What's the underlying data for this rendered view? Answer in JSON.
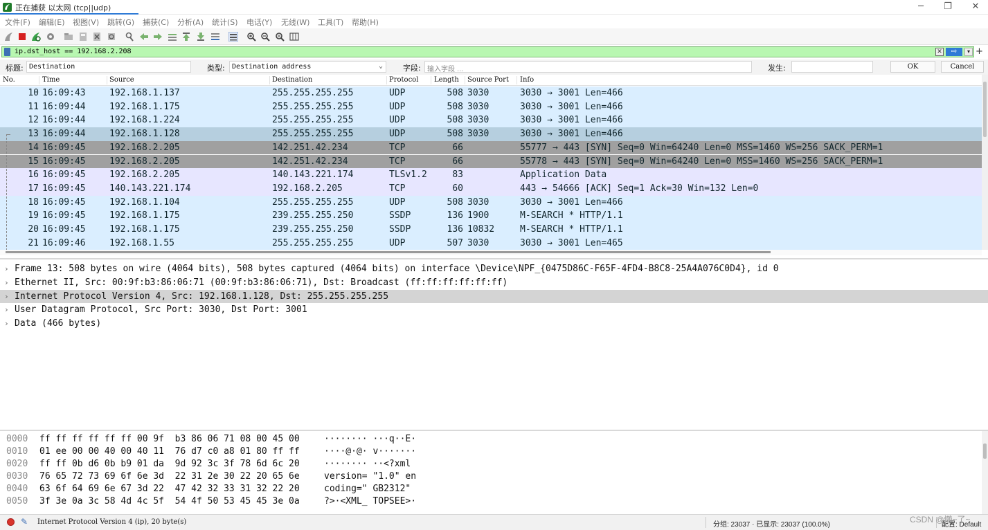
{
  "window": {
    "title": "正在捕获 以太网 (tcp||udp)",
    "minimize": "─",
    "maximize": "❐",
    "close": "✕"
  },
  "menu": [
    "文件(F)",
    "编辑(E)",
    "视图(V)",
    "跳转(G)",
    "捕获(C)",
    "分析(A)",
    "统计(S)",
    "电话(Y)",
    "无线(W)",
    "工具(T)",
    "帮助(H)"
  ],
  "toolbar_icons": [
    "shark-fin-icon",
    "stop-icon",
    "restart-icon",
    "options-icon",
    "open-file-icon",
    "save-file-icon",
    "close-file-icon",
    "reload-icon",
    "find-icon",
    "back-icon",
    "forward-icon",
    "goto-packet-icon",
    "first-packet-icon",
    "last-packet-icon",
    "autoscroll-icon",
    "colorize-icon",
    "zoom-in-icon",
    "zoom-out-icon",
    "normal-size-icon",
    "resize-columns-icon"
  ],
  "filter": {
    "value": "ip.dst_host  == 192.168.2.208",
    "clear": "✕",
    "apply": "⇨",
    "dropdown": "▾",
    "add": "+"
  },
  "column_editor": {
    "title_label": "标题:",
    "title_value": "Destination",
    "type_label": "类型:",
    "type_value": "Destination address",
    "field_label": "字段:",
    "field_placeholder": "输入字段 …",
    "occurrence_label": "发生:",
    "occurrence_value": "",
    "ok": "OK",
    "cancel": "Cancel"
  },
  "packet_list": {
    "columns": [
      "No.",
      "Time",
      "Source",
      "Destination",
      "Protocol",
      "Length",
      "Source Port",
      "Info"
    ],
    "rows": [
      {
        "no": "10",
        "time": "16:09:43",
        "src": "192.168.1.137",
        "dst": "255.255.255.255",
        "proto": "UDP",
        "len": "508",
        "sport": "3030",
        "info": "3030 → 3001 Len=466",
        "bg": "#daeeff",
        "fg": "#12272e"
      },
      {
        "no": "11",
        "time": "16:09:44",
        "src": "192.168.1.175",
        "dst": "255.255.255.255",
        "proto": "UDP",
        "len": "508",
        "sport": "3030",
        "info": "3030 → 3001 Len=466",
        "bg": "#daeeff",
        "fg": "#12272e"
      },
      {
        "no": "12",
        "time": "16:09:44",
        "src": "192.168.1.224",
        "dst": "255.255.255.255",
        "proto": "UDP",
        "len": "508",
        "sport": "3030",
        "info": "3030 → 3001 Len=466",
        "bg": "#daeeff",
        "fg": "#12272e"
      },
      {
        "no": "13",
        "time": "16:09:44",
        "src": "192.168.1.128",
        "dst": "255.255.255.255",
        "proto": "UDP",
        "len": "508",
        "sport": "3030",
        "info": "3030 → 3001 Len=466",
        "bg": "#b6cfdf",
        "fg": "#12272e"
      },
      {
        "no": "14",
        "time": "16:09:45",
        "src": "192.168.2.205",
        "dst": "142.251.42.234",
        "proto": "TCP",
        "len": "66",
        "sport": "",
        "info": "55777 → 443 [SYN] Seq=0 Win=64240 Len=0 MSS=1460 WS=256 SACK_PERM=1",
        "bg": "#a0a0a0",
        "fg": "#12272e"
      },
      {
        "no": "15",
        "time": "16:09:45",
        "src": "192.168.2.205",
        "dst": "142.251.42.234",
        "proto": "TCP",
        "len": "66",
        "sport": "",
        "info": "55778 → 443 [SYN] Seq=0 Win=64240 Len=0 MSS=1460 WS=256 SACK_PERM=1",
        "bg": "#a0a0a0",
        "fg": "#12272e"
      },
      {
        "no": "16",
        "time": "16:09:45",
        "src": "192.168.2.205",
        "dst": "140.143.221.174",
        "proto": "TLSv1.2",
        "len": "83",
        "sport": "",
        "info": "Application Data",
        "bg": "#e7e6ff",
        "fg": "#12272e"
      },
      {
        "no": "17",
        "time": "16:09:45",
        "src": "140.143.221.174",
        "dst": "192.168.2.205",
        "proto": "TCP",
        "len": "60",
        "sport": "",
        "info": "443 → 54666 [ACK] Seq=1 Ack=30 Win=132 Len=0",
        "bg": "#e7e6ff",
        "fg": "#12272e"
      },
      {
        "no": "18",
        "time": "16:09:45",
        "src": "192.168.1.104",
        "dst": "255.255.255.255",
        "proto": "UDP",
        "len": "508",
        "sport": "3030",
        "info": "3030 → 3001 Len=466",
        "bg": "#daeeff",
        "fg": "#12272e"
      },
      {
        "no": "19",
        "time": "16:09:45",
        "src": "192.168.1.175",
        "dst": "239.255.255.250",
        "proto": "SSDP",
        "len": "136",
        "sport": "1900",
        "info": "M-SEARCH * HTTP/1.1",
        "bg": "#daeeff",
        "fg": "#12272e"
      },
      {
        "no": "20",
        "time": "16:09:45",
        "src": "192.168.1.175",
        "dst": "239.255.255.250",
        "proto": "SSDP",
        "len": "136",
        "sport": "10832",
        "info": "M-SEARCH * HTTP/1.1",
        "bg": "#daeeff",
        "fg": "#12272e"
      },
      {
        "no": "21",
        "time": "16:09:46",
        "src": "192.168.1.55",
        "dst": "255.255.255.255",
        "proto": "UDP",
        "len": "507",
        "sport": "3030",
        "info": "3030 → 3001 Len=465",
        "bg": "#daeeff",
        "fg": "#12272e"
      }
    ]
  },
  "details": [
    {
      "text": "Frame 13: 508 bytes on wire (4064 bits), 508 bytes captured (4064 bits) on interface \\Device\\NPF_{0475D86C-F65F-4FD4-B8C8-25A4A076C0D4}, id 0",
      "bg": "#ffffff"
    },
    {
      "text": "Ethernet II, Src: 00:9f:b3:86:06:71 (00:9f:b3:86:06:71), Dst: Broadcast (ff:ff:ff:ff:ff:ff)",
      "bg": "#ffffff"
    },
    {
      "text": "Internet Protocol Version 4, Src: 192.168.1.128, Dst: 255.255.255.255",
      "bg": "#d4d4d4"
    },
    {
      "text": "User Datagram Protocol, Src Port: 3030, Dst Port: 3001",
      "bg": "#ffffff"
    },
    {
      "text": "Data (466 bytes)",
      "bg": "#ffffff"
    }
  ],
  "bytes": [
    {
      "off": "0000",
      "hex": "ff ff ff ff ff ff 00 9f  b3 86 06 71 08 00 45 00",
      "ascii": "········ ···q··E·"
    },
    {
      "off": "0010",
      "hex": "01 ee 00 00 40 00 40 11  76 d7 c0 a8 01 80 ff ff",
      "ascii": "····@·@· v·······"
    },
    {
      "off": "0020",
      "hex": "ff ff 0b d6 0b b9 01 da  9d 92 3c 3f 78 6d 6c 20",
      "ascii": "········ ··<?xml "
    },
    {
      "off": "0030",
      "hex": "76 65 72 73 69 6f 6e 3d  22 31 2e 30 22 20 65 6e",
      "ascii": "version= \"1.0\" en"
    },
    {
      "off": "0040",
      "hex": "63 6f 64 69 6e 67 3d 22  47 42 32 33 31 32 22 20",
      "ascii": "coding=\" GB2312\" "
    },
    {
      "off": "0050",
      "hex": "3f 3e 0a 3c 58 4d 4c 5f  54 4f 50 53 45 45 3e 0a",
      "ascii": "?>·<XML_ TOPSEE>·"
    }
  ],
  "status": {
    "text": "Internet Protocol Version 4 (ip), 20 byte(s)",
    "stats": "分组: 23037 · 已显示: 23037 (100.0%)",
    "profile": "配置: Default"
  },
  "watermark": "CSDN @懒~了~"
}
